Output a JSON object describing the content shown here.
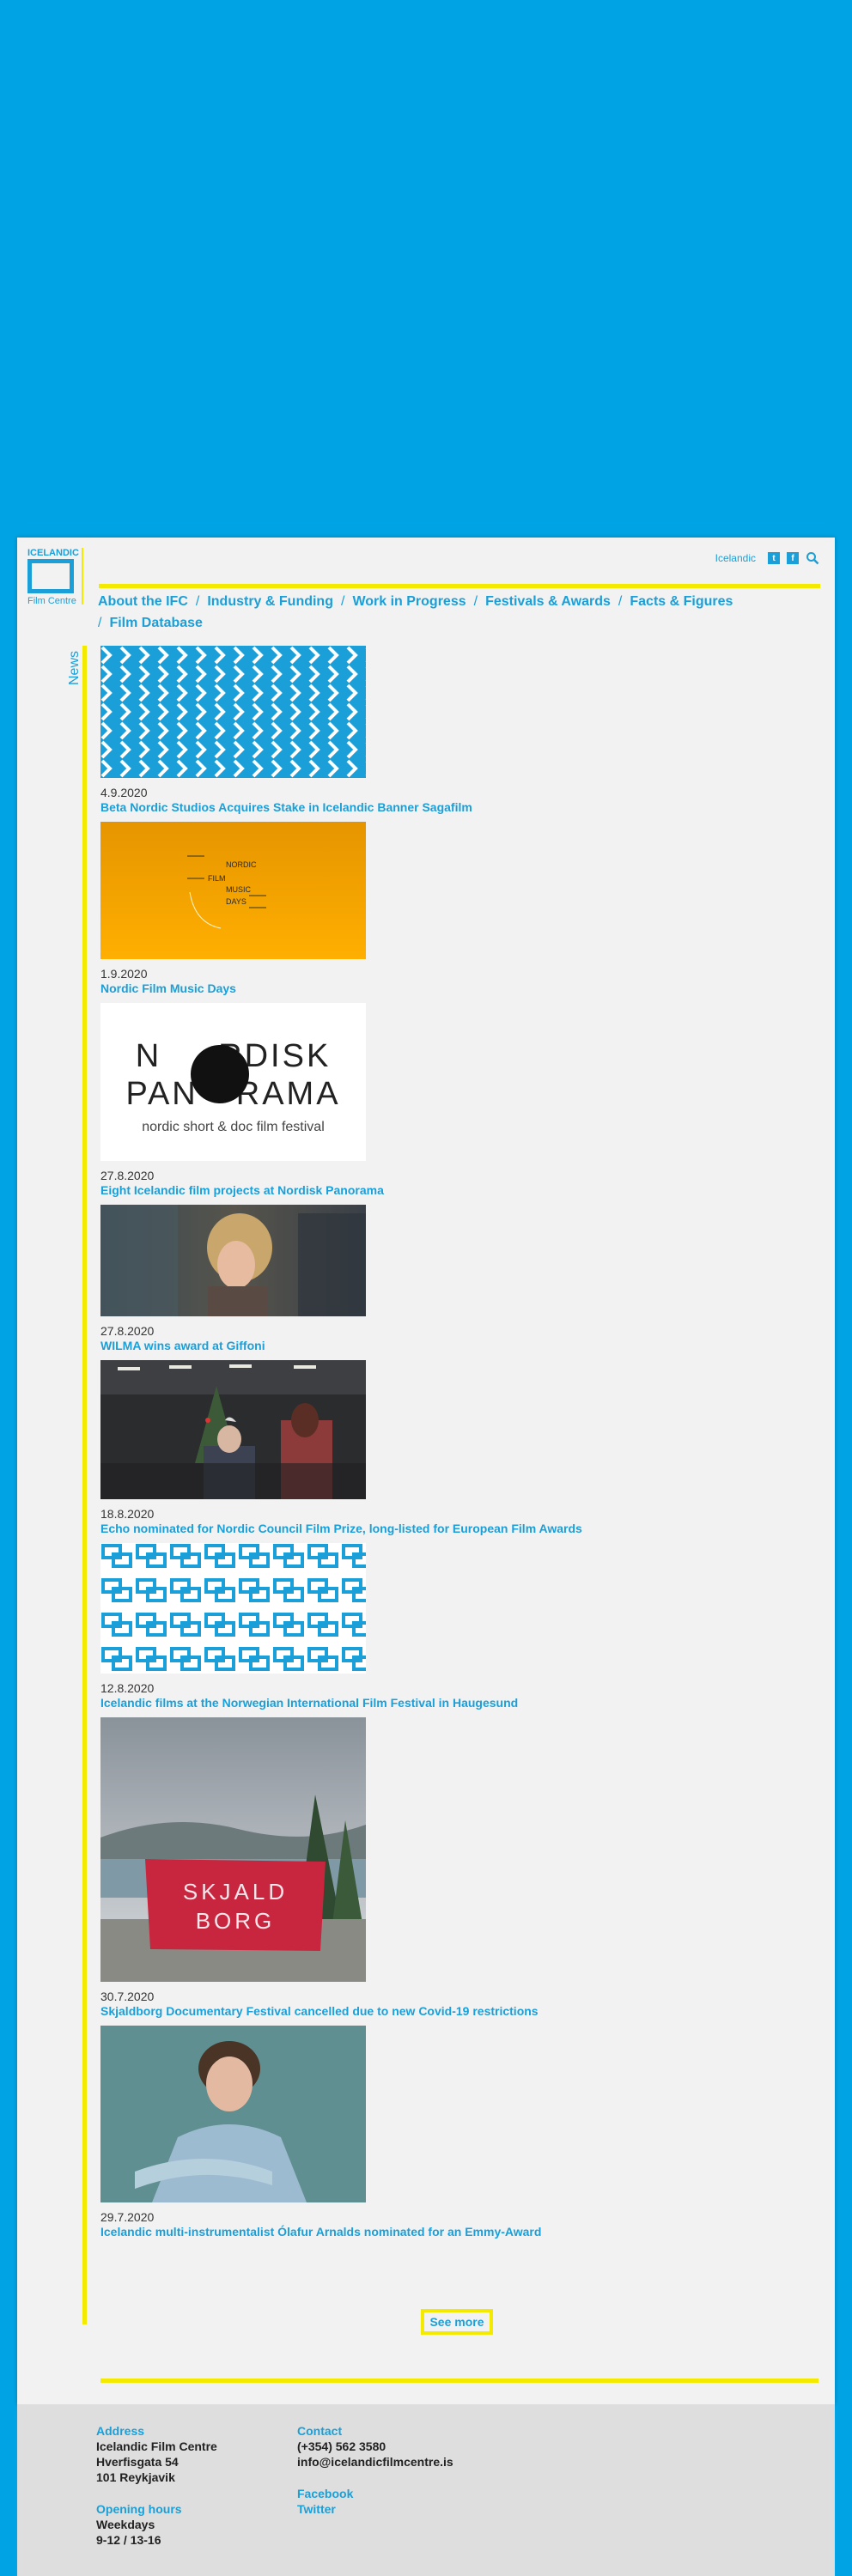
{
  "brand": {
    "logo_top": "ICELANDIC",
    "logo_bottom": "Film Centre"
  },
  "topbar": {
    "language": "Icelandic",
    "social": [
      "twitter-icon",
      "facebook-icon"
    ],
    "search_icon": "search-icon"
  },
  "nav": {
    "items": [
      "About the IFC",
      "Industry & Funding",
      "Work in Progress",
      "Festivals & Awards",
      "Facts & Figures",
      "Film Database"
    ],
    "separator": "/"
  },
  "section_label": "News",
  "news": [
    {
      "date": "4.9.2020",
      "title": "Beta Nordic Studios Acquires Stake in Icelandic Banner Sagafilm",
      "image": "blue-chevron-pattern"
    },
    {
      "date": "1.9.2020",
      "title": "Nordic Film Music Days",
      "image": "nordic-film-music-days-poster",
      "poster_text": [
        "NORDIC",
        "FILM",
        "MUSIC",
        "DAYS"
      ]
    },
    {
      "date": "27.8.2020",
      "title": "Eight Icelandic film projects at Nordisk Panorama",
      "image": "nordisk-panorama-logo",
      "logo_line1_a": "N",
      "logo_line1_b": "RDISK",
      "logo_line2_a": "PAN",
      "logo_line2_b": "RAMA",
      "logo_tagline": "nordic short & doc film festival"
    },
    {
      "date": "27.8.2020",
      "title": "WILMA wins award at Giffoni",
      "image": "film-still-child"
    },
    {
      "date": "18.8.2020",
      "title": "Echo nominated for Nordic Council Film Prize, long-listed for European Film Awards",
      "image": "film-still-office-christmas"
    },
    {
      "date": "12.8.2020",
      "title": "Icelandic films at the Norwegian International Film Festival in Haugesund",
      "image": "blue-square-pattern"
    },
    {
      "date": "30.7.2020",
      "title": "Skjaldborg Documentary Festival cancelled due to new Covid-19 restrictions",
      "image": "skjaldborg-banner-photo",
      "banner_text": [
        "SKJALD",
        "BORG"
      ]
    },
    {
      "date": "29.7.2020",
      "title": "Icelandic multi-instrumentalist Ólafur Arnalds nominated for an Emmy-Award",
      "image": "portrait-photo"
    }
  ],
  "see_more": "See more",
  "footer": {
    "address_label": "Address",
    "address_lines": [
      "Icelandic Film Centre",
      "Hverfisgata 54",
      "101 Reykjavik"
    ],
    "hours_label": "Opening hours",
    "hours_lines": [
      "Weekdays",
      "9-12 / 13-16"
    ],
    "contact_label": "Contact",
    "contact_lines": [
      "(+354) 562 3580",
      "info@icelandicfilmcentre.is"
    ],
    "social_links": [
      "Facebook",
      "Twitter"
    ]
  },
  "colors": {
    "background": "#00a4e4",
    "accent_blue": "#1a9fd8",
    "accent_yellow": "#f4ea00",
    "page": "#f2f2f2",
    "footer": "#dedede"
  }
}
